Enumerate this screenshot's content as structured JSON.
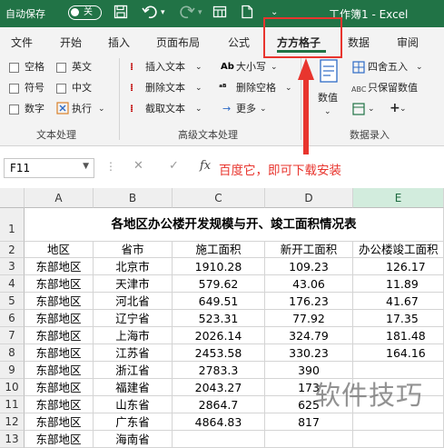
{
  "titlebar": {
    "autosave_label": "自动保存",
    "toggle_state": "关",
    "workbook_title": "工作簿1 - Excel",
    "accent": "#217346"
  },
  "tabs": [
    "文件",
    "开始",
    "插入",
    "页面布局",
    "公式",
    "方方格子",
    "数据",
    "审阅"
  ],
  "active_tab": "方方格子",
  "ribbon": {
    "text_group": {
      "checkboxes": [
        "空格",
        "英文",
        "符号",
        "中文",
        "数字"
      ],
      "execute_label": "执行",
      "group_label": "文本处理"
    },
    "advanced_group": {
      "insert_text": "插入文本",
      "delete_text": "删除文本",
      "extract_text": "截取文本",
      "case_label": "大小写",
      "delete_spaces": "删除空格",
      "more_label": "更多",
      "group_label": "高级文本处理"
    },
    "data_entry_group": {
      "value_label": "数值",
      "round_label": "四舍五入",
      "keep_value": "只保留数值",
      "group_label": "数据录入"
    }
  },
  "formula_bar": {
    "name_box": "F11",
    "fx_label": "fx",
    "annotation": "百度它，即可下载安装"
  },
  "annotation_color": "#e8352e",
  "columns": [
    "A",
    "B",
    "C",
    "D",
    "E"
  ],
  "rows": [
    {
      "n": "1",
      "cells": [
        "各地区办公楼开发规模与开、竣工面积情况表"
      ]
    },
    {
      "n": "2",
      "cells": [
        "地区",
        "省市",
        "施工面积",
        "新开工面积",
        "办公楼竣工面积"
      ]
    },
    {
      "n": "3",
      "cells": [
        "东部地区",
        "北京市",
        "1910.28",
        "109.23",
        "126.17"
      ]
    },
    {
      "n": "4",
      "cells": [
        "东部地区",
        "天津市",
        "579.62",
        "43.06",
        "11.89"
      ]
    },
    {
      "n": "5",
      "cells": [
        "东部地区",
        "河北省",
        "649.51",
        "176.23",
        "41.67"
      ]
    },
    {
      "n": "6",
      "cells": [
        "东部地区",
        "辽宁省",
        "523.31",
        "77.92",
        "17.35"
      ]
    },
    {
      "n": "7",
      "cells": [
        "东部地区",
        "上海市",
        "2026.14",
        "324.79",
        "181.48"
      ]
    },
    {
      "n": "8",
      "cells": [
        "东部地区",
        "江苏省",
        "2453.58",
        "330.23",
        "164.16"
      ]
    },
    {
      "n": "9",
      "cells": [
        "东部地区",
        "浙江省",
        "2783.3",
        "390",
        ""
      ]
    },
    {
      "n": "10",
      "cells": [
        "东部地区",
        "福建省",
        "2043.27",
        "173",
        ""
      ]
    },
    {
      "n": "11",
      "cells": [
        "东部地区",
        "山东省",
        "2864.7",
        "625",
        ""
      ]
    },
    {
      "n": "12",
      "cells": [
        "东部地区",
        "广东省",
        "4864.83",
        "817",
        ""
      ]
    },
    {
      "n": "13",
      "cells": [
        "东部地区",
        "海南省",
        "",
        "",
        ""
      ]
    }
  ],
  "watermark": "软件技巧"
}
